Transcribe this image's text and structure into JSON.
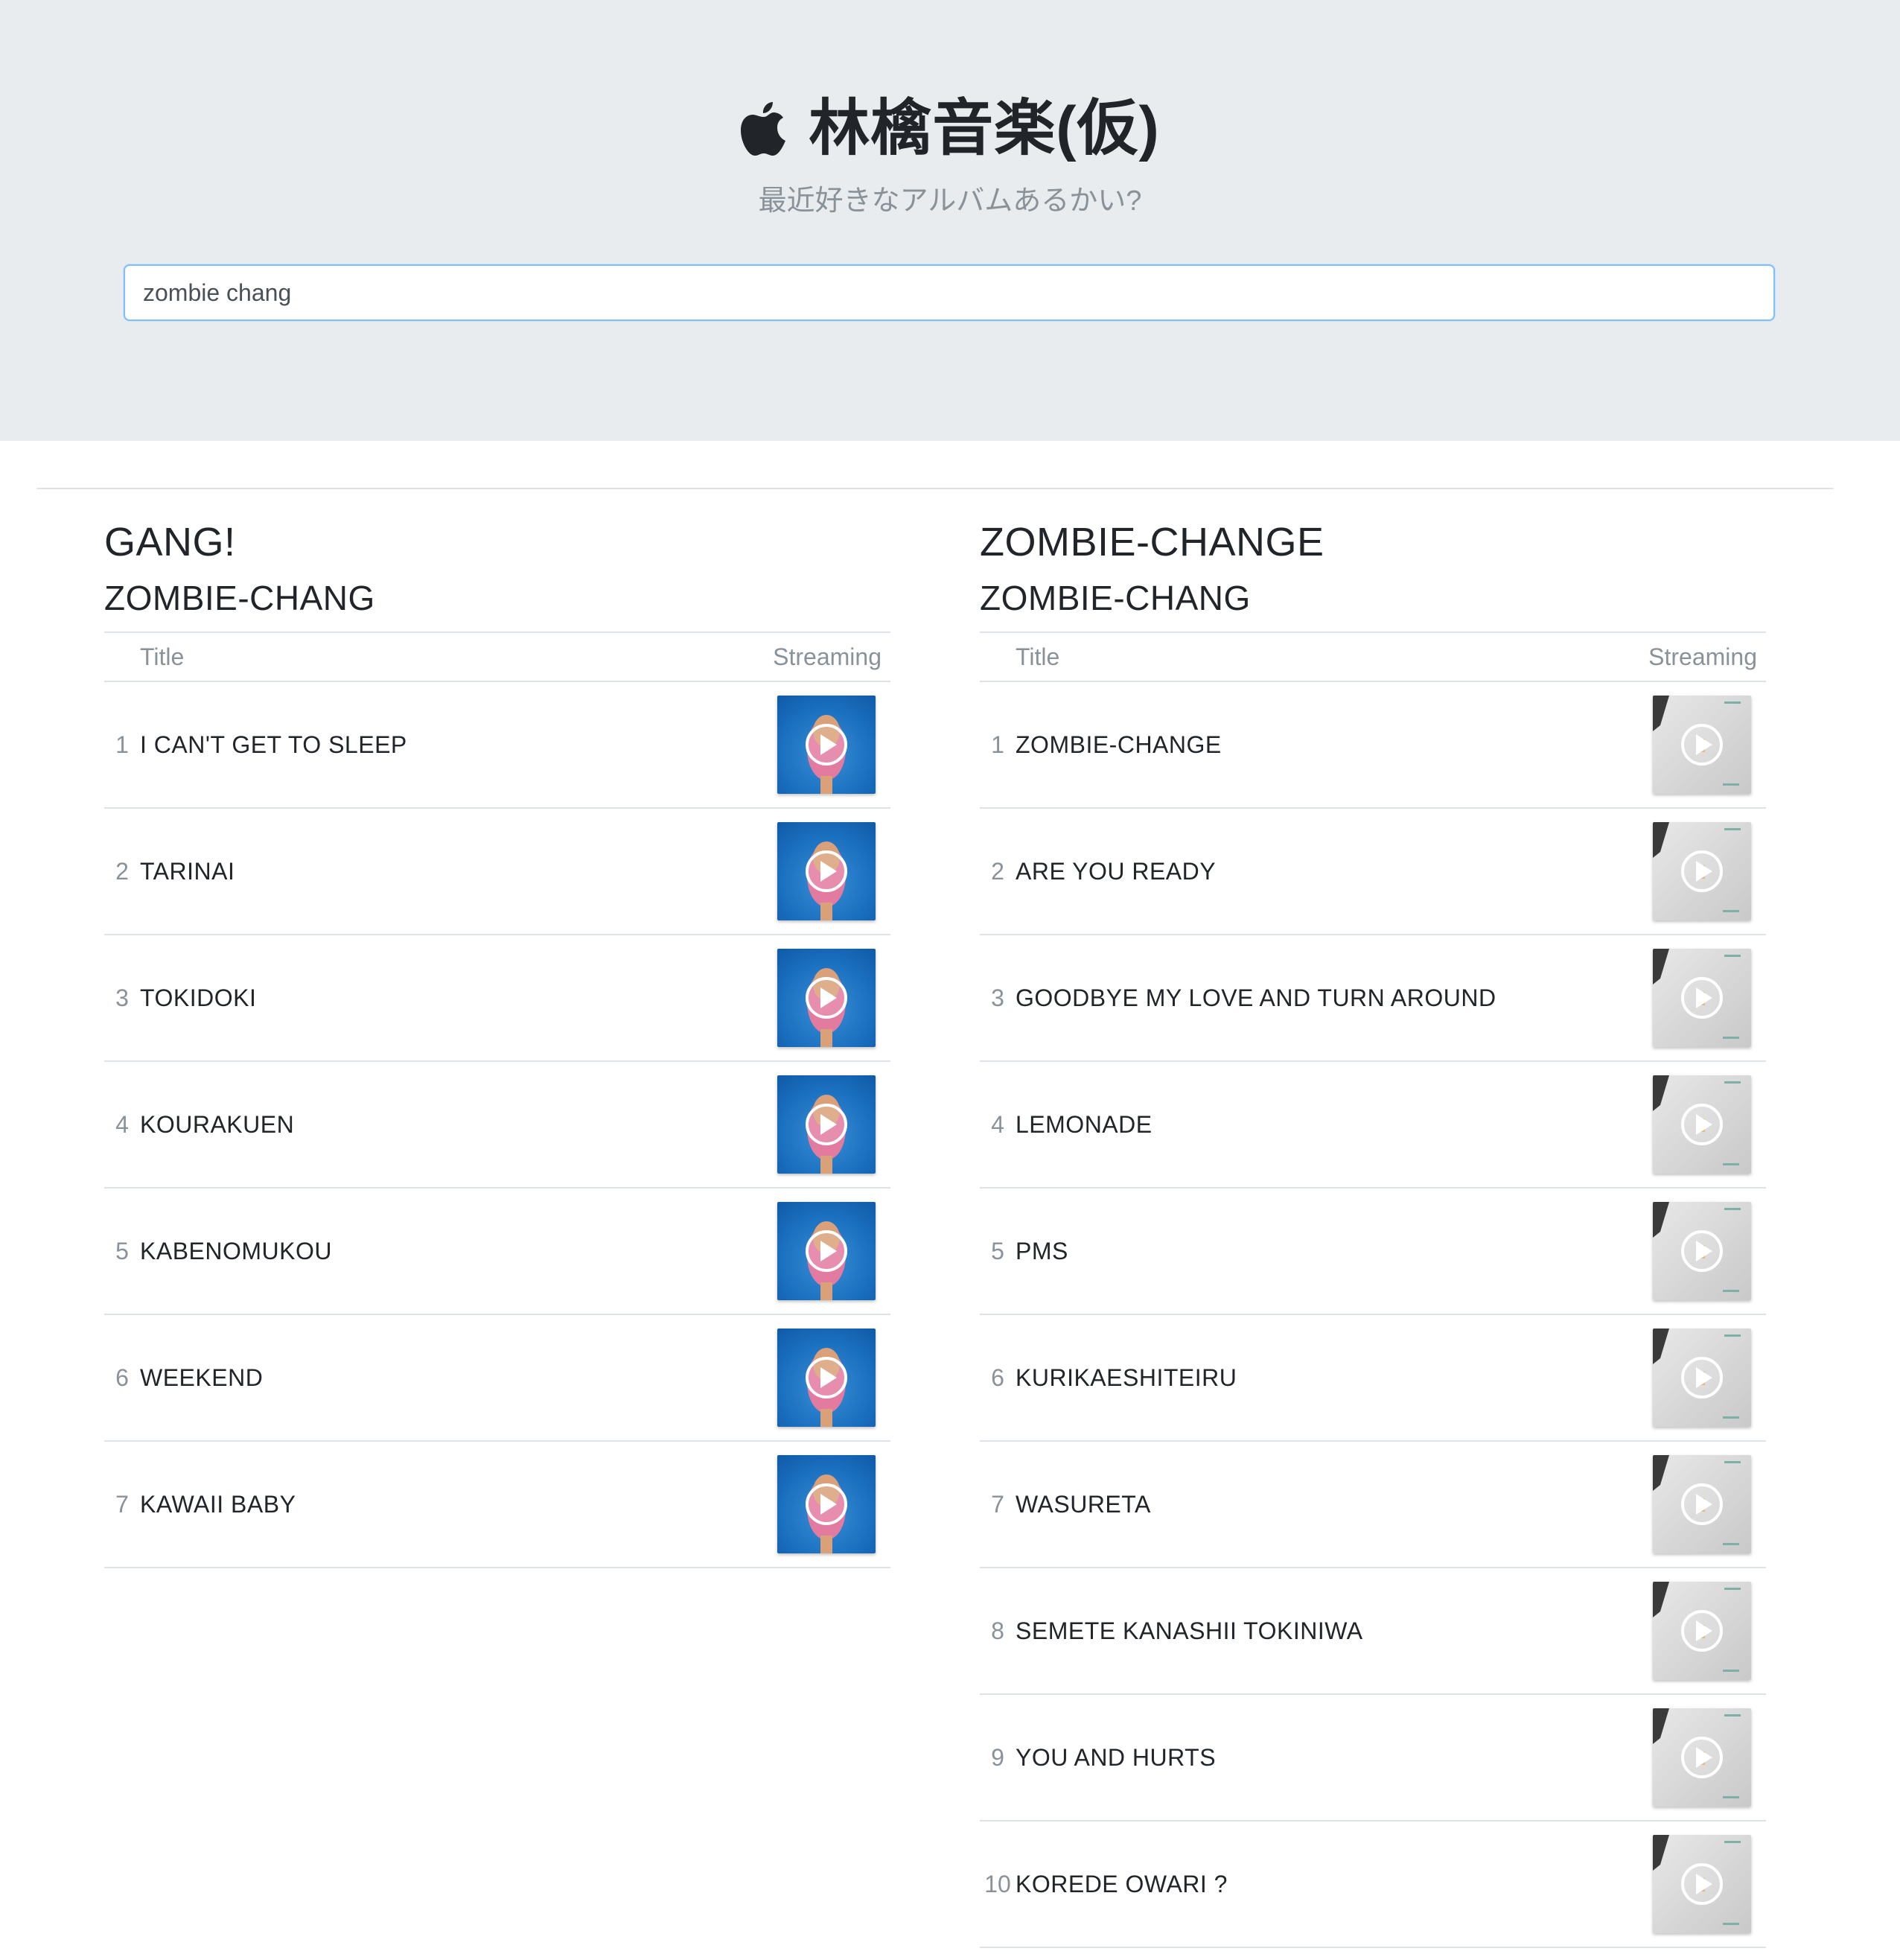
{
  "header": {
    "title": "林檎音楽(仮)",
    "subtitle": "最近好きなアルバムあるかい?",
    "logo_icon": "apple-icon"
  },
  "search": {
    "value": "zombie chang"
  },
  "table_headers": {
    "title": "Title",
    "streaming": "Streaming"
  },
  "albums": [
    {
      "title": "GANG!",
      "artist": "ZOMBIE-CHANG",
      "cover_color": "#1a6fbf",
      "tracks": [
        {
          "num": "1",
          "title": "I CAN'T GET TO SLEEP"
        },
        {
          "num": "2",
          "title": "TARINAI"
        },
        {
          "num": "3",
          "title": "TOKIDOKI"
        },
        {
          "num": "4",
          "title": "KOURAKUEN"
        },
        {
          "num": "5",
          "title": "KABENOMUKOU"
        },
        {
          "num": "6",
          "title": "WEEKEND"
        },
        {
          "num": "7",
          "title": "KAWAII BABY"
        }
      ]
    },
    {
      "title": "ZOMBIE-CHANGE",
      "artist": "ZOMBIE-CHANG",
      "cover_color": "#d8d8d8",
      "tracks": [
        {
          "num": "1",
          "title": "ZOMBIE-CHANGE"
        },
        {
          "num": "2",
          "title": "ARE YOU READY"
        },
        {
          "num": "3",
          "title": "GOODBYE MY LOVE AND TURN AROUND"
        },
        {
          "num": "4",
          "title": "LEMONADE"
        },
        {
          "num": "5",
          "title": "PMS"
        },
        {
          "num": "6",
          "title": "KURIKAESHITEIRU"
        },
        {
          "num": "7",
          "title": "WASURETA"
        },
        {
          "num": "8",
          "title": "SEMETE KANASHII TOKINIWA"
        },
        {
          "num": "9",
          "title": "YOU AND HURTS"
        },
        {
          "num": "10",
          "title": "KOREDE OWARI ?"
        }
      ]
    }
  ]
}
